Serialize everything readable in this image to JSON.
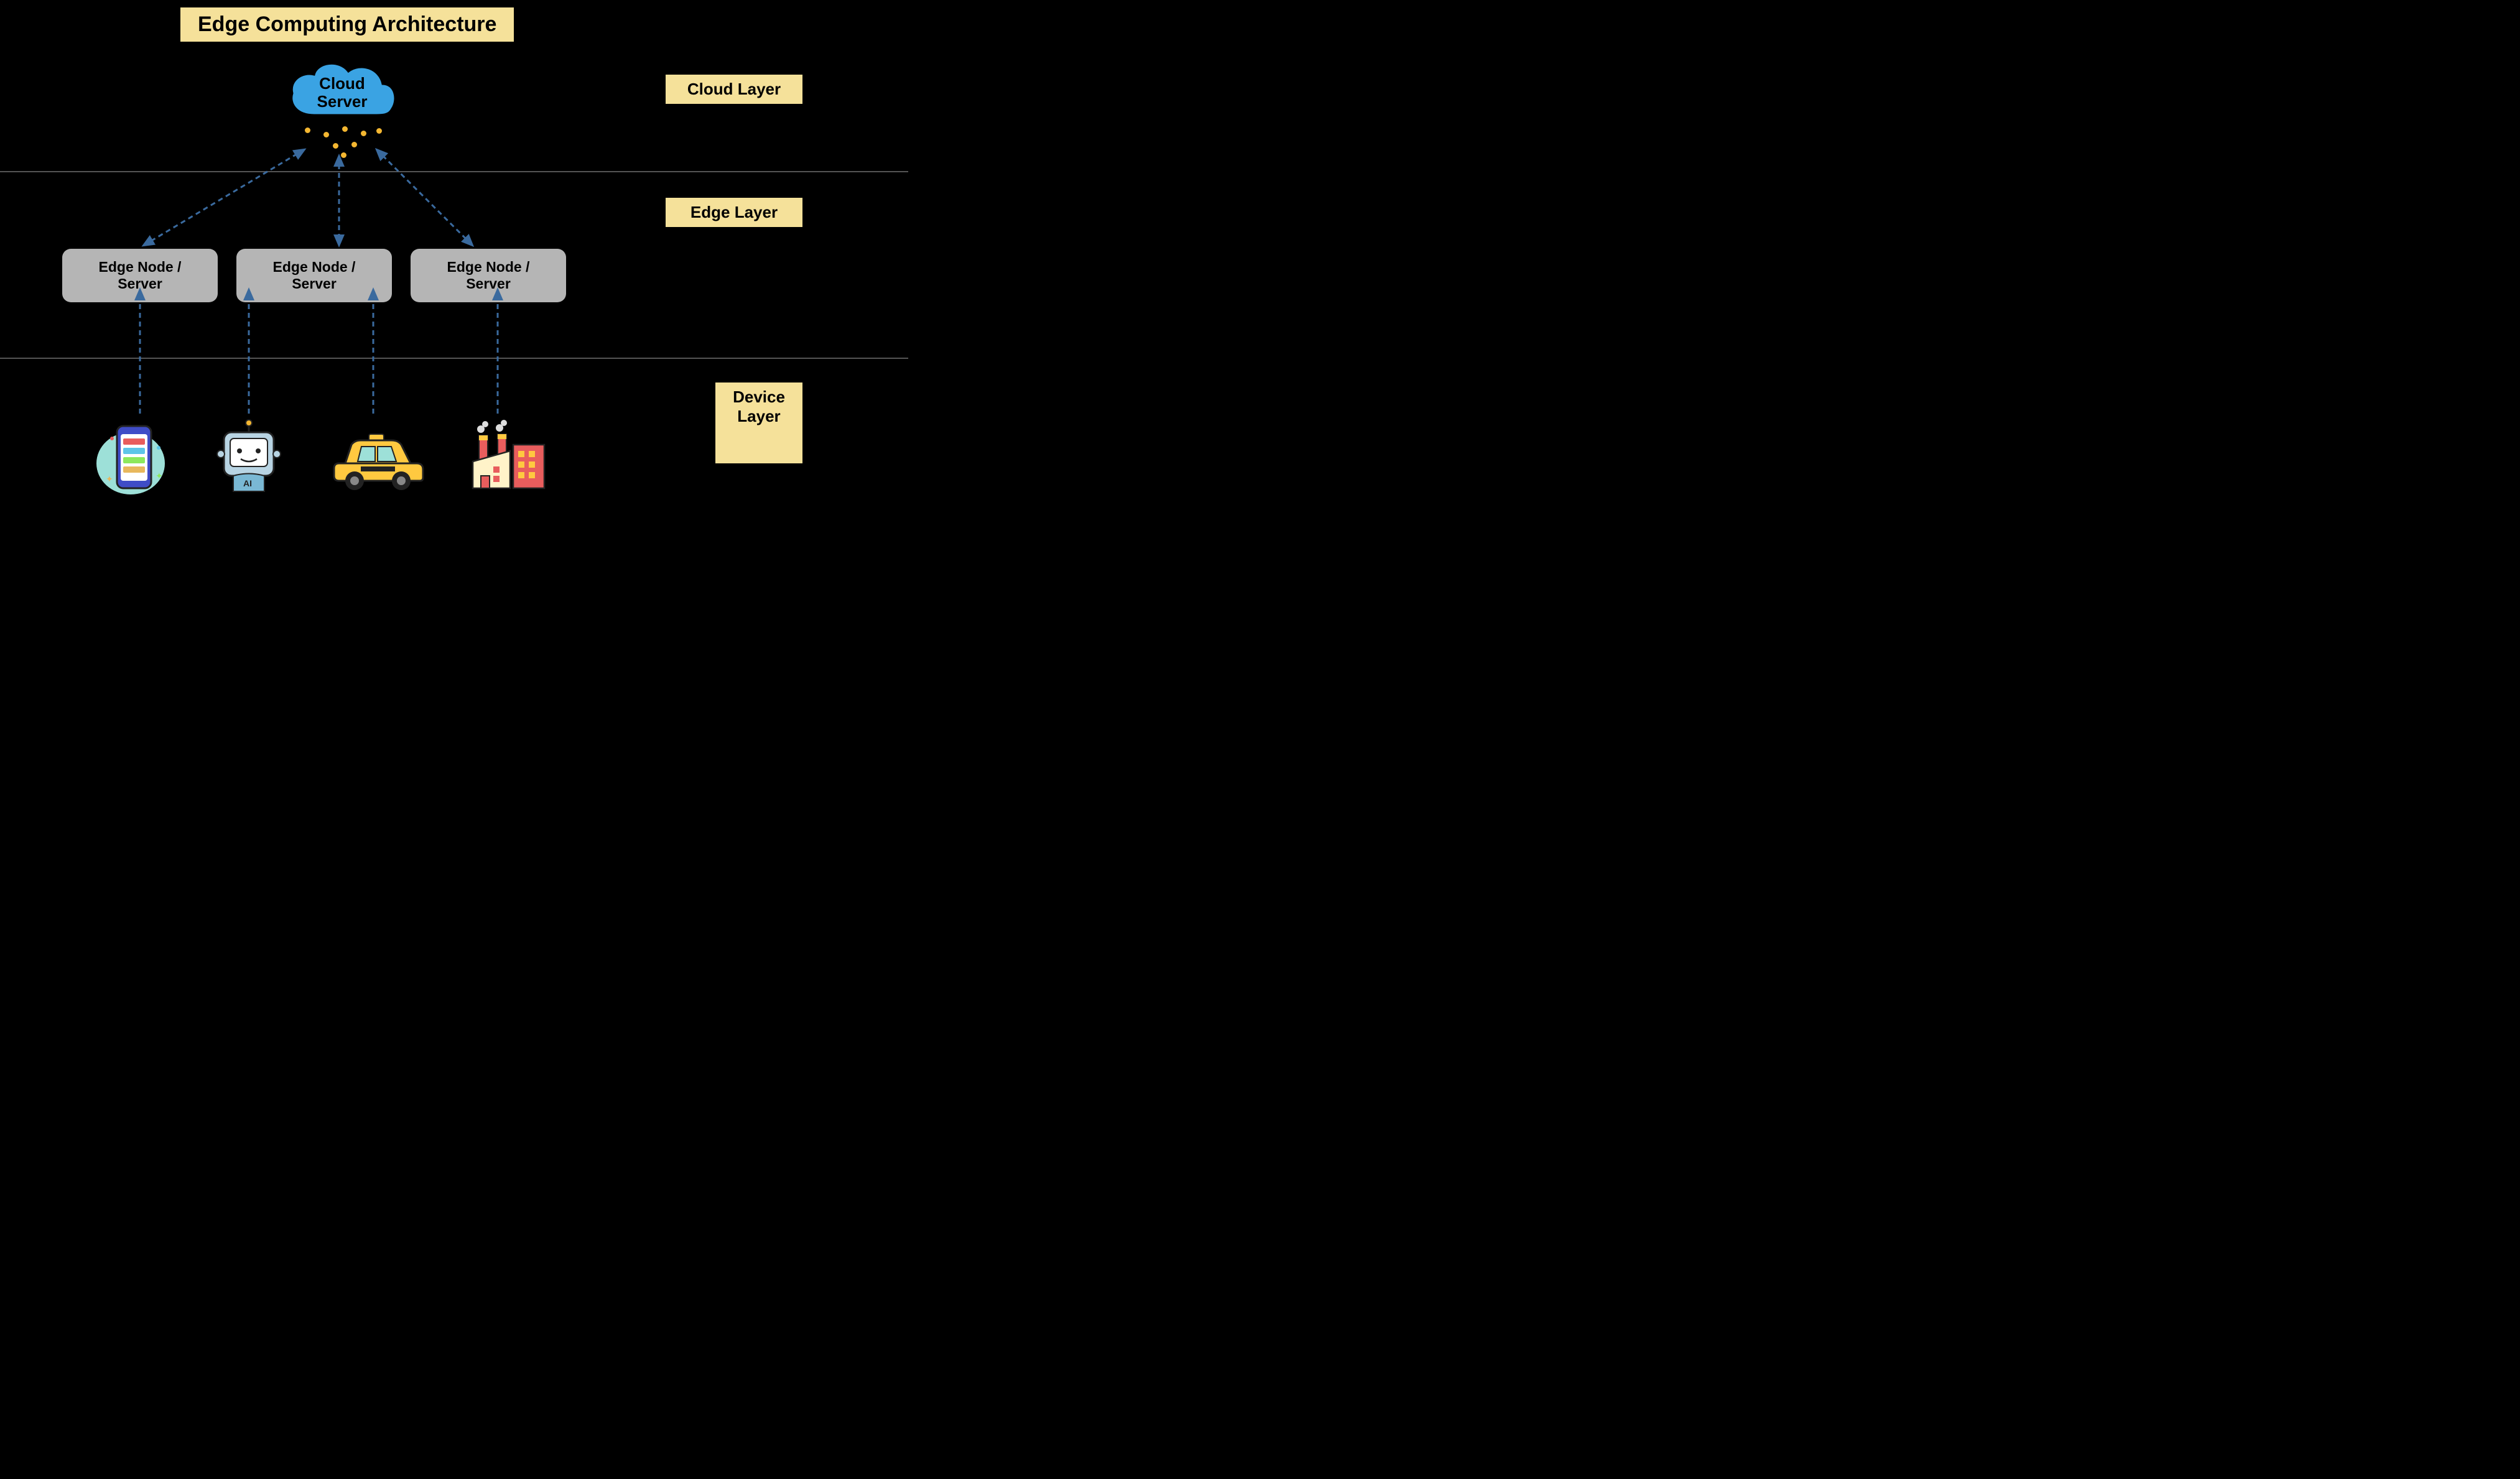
{
  "title": "Edge Computing Architecture",
  "layers": {
    "cloud": {
      "label": "Cloud Layer"
    },
    "edge": {
      "label": "Edge Layer"
    },
    "device": {
      "label": "Device Layer"
    }
  },
  "cloud_server": {
    "line1": "Cloud",
    "line2": "Server"
  },
  "edge_nodes": [
    {
      "label": "Edge Node / Server"
    },
    {
      "label": "Edge Node / Server"
    },
    {
      "label": "Edge Node / Server"
    }
  ],
  "devices": [
    {
      "name": "smartphone-app"
    },
    {
      "name": "ai-robot"
    },
    {
      "name": "taxi-car"
    },
    {
      "name": "factory"
    }
  ],
  "colors": {
    "banner": "#f5e19a",
    "cloud_fill": "#3aa3e3",
    "edge_box": "#b5b5b5",
    "arrow": "#3a6a9e"
  }
}
